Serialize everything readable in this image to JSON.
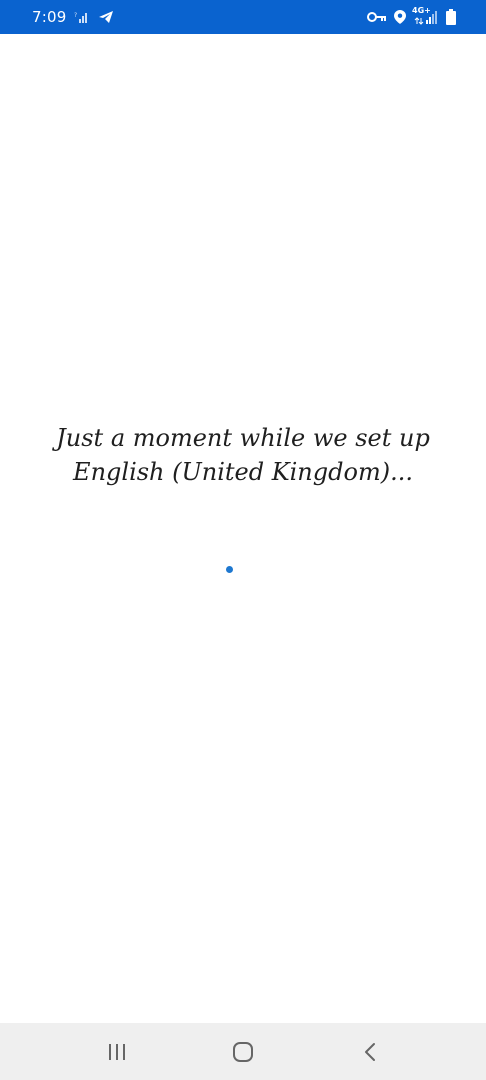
{
  "status_bar": {
    "time": "7:09",
    "network_type": "4G+",
    "colors": {
      "background": "#0a63cf",
      "foreground": "#ffffff"
    },
    "icons": [
      "call-signal-icon",
      "telegram-icon",
      "vpn-key-icon",
      "location-icon",
      "signal-strength-icon",
      "battery-icon"
    ]
  },
  "main": {
    "message_line1": "Just a moment while we set up",
    "message_line2": "English (United Kingdom)...",
    "loader_color": "#1e78d0"
  },
  "nav_bar": {
    "icons": [
      "recent-apps-icon",
      "home-icon",
      "back-icon"
    ],
    "background": "#efefef"
  }
}
